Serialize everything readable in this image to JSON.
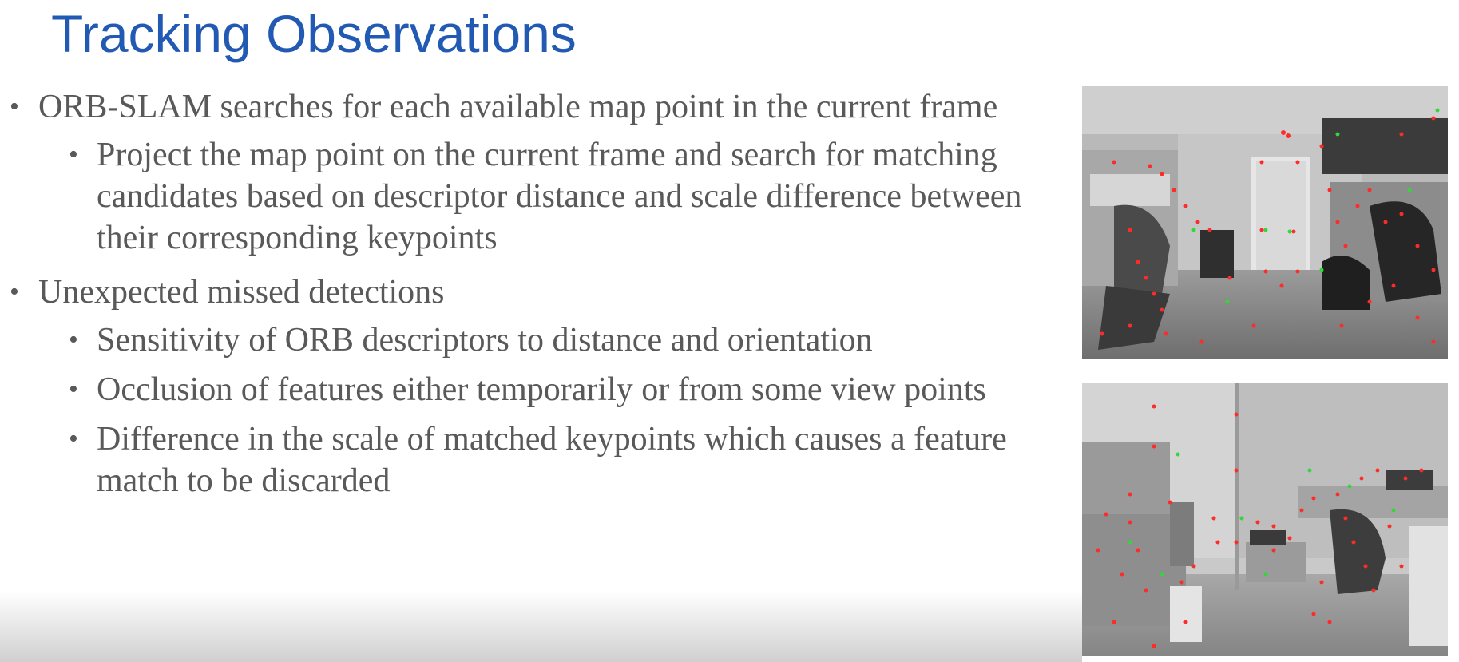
{
  "slide": {
    "title": "Tracking Observations",
    "bullets": [
      {
        "text": "ORB-SLAM searches for each available map point in the current frame",
        "sub": [
          "Project the map point on the current frame and search for matching candidates based on descriptor distance and scale difference between their corresponding keypoints"
        ]
      },
      {
        "text": "Unexpected missed detections",
        "sub": [
          "Sensitivity of ORB descriptors to distance and orientation",
          "Occlusion of features either temporarily or from some view points",
          "Difference in the scale of matched keypoints which causes a feature match to be discarded"
        ]
      }
    ]
  },
  "images": {
    "top": {
      "kind": "orb-feature-photo"
    },
    "bottom": {
      "kind": "orb-feature-photo"
    }
  },
  "colors": {
    "title": "#2159b3",
    "body_text": "#595959",
    "feature_match": "#ff2a2a",
    "feature_inlier": "#35d63a"
  }
}
